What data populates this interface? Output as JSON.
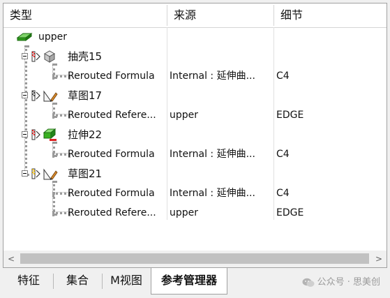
{
  "columns": {
    "type": "类型",
    "source": "来源",
    "detail": "细节"
  },
  "root": {
    "label": "upper"
  },
  "rows": [
    {
      "label": "抽壳15",
      "source": "",
      "detail": ""
    },
    {
      "label": "Rerouted Formula",
      "source": "Internal : 延伸曲...",
      "detail": "C4"
    },
    {
      "label": "草图17",
      "source": "",
      "detail": ""
    },
    {
      "label": "Rerouted Refere...",
      "source": "upper",
      "detail": "EDGE"
    },
    {
      "label": "拉伸22",
      "source": "",
      "detail": ""
    },
    {
      "label": "Rerouted Formula",
      "source": "Internal : 延伸曲...",
      "detail": "C4"
    },
    {
      "label": "草图21",
      "source": "",
      "detail": ""
    },
    {
      "label": "Rerouted Formula",
      "source": "Internal : 延伸曲...",
      "detail": "C4"
    },
    {
      "label": "Rerouted Refere...",
      "source": "upper",
      "detail": "EDGE"
    }
  ],
  "scrollbar": {
    "left_arrow": "<",
    "right_arrow": ">"
  },
  "tabs": [
    {
      "label": "特征"
    },
    {
      "label": "集合"
    },
    {
      "label": "M视图"
    },
    {
      "label": "参考管理器"
    }
  ],
  "watermark": {
    "text": "公众号 · 思美创"
  }
}
